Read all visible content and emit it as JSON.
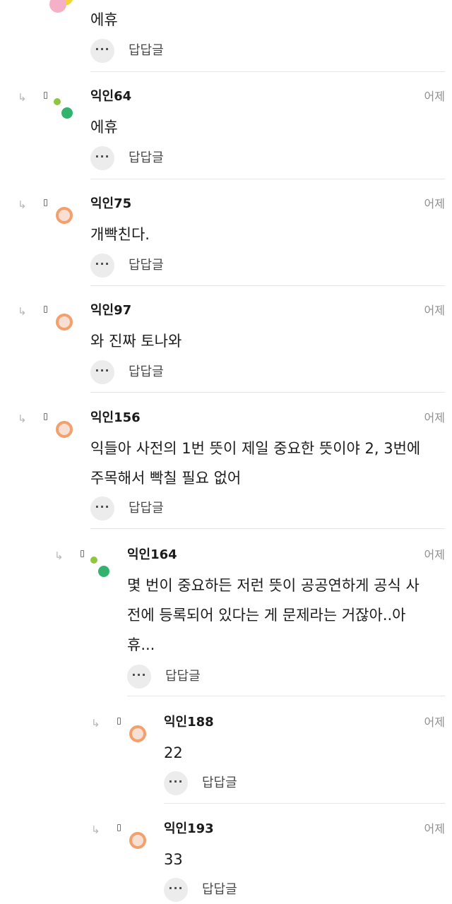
{
  "comments": [
    {
      "name": "",
      "time": "",
      "text": "에휴",
      "more": "···",
      "reply_label": "답답글",
      "avatar": "avatar-yellow-pink",
      "indent": 0,
      "show_reply_arrow": false
    },
    {
      "name": "익인64",
      "time": "어제",
      "text": "에휴",
      "more": "···",
      "reply_label": "답답글",
      "avatar": "avatar-green-dots",
      "indent": 0,
      "show_reply_arrow": true
    },
    {
      "name": "익인75",
      "time": "어제",
      "text": "개빡친다.",
      "more": "···",
      "reply_label": "답답글",
      "avatar": "avatar-orange-ring",
      "indent": 0,
      "show_reply_arrow": true
    },
    {
      "name": "익인97",
      "time": "어제",
      "text": "와 진짜 토나와",
      "more": "···",
      "reply_label": "답답글",
      "avatar": "avatar-orange-ring",
      "indent": 0,
      "show_reply_arrow": true
    },
    {
      "name": "익인156",
      "time": "어제",
      "text": "익들아 사전의 1번 뜻이 제일 중요한 뜻이야 2, 3번에\n주목해서 빡칠 필요 없어",
      "more": "···",
      "reply_label": "답답글",
      "avatar": "avatar-orange-ring",
      "indent": 0,
      "show_reply_arrow": true
    },
    {
      "name": "익인164",
      "time": "어제",
      "text": "몇 번이 중요하든 저런 뜻이 공공연하게 공식 사\n전에 등록되어 있다는 게 문제라는 거잖아..아\n휴...",
      "more": "···",
      "reply_label": "답답글",
      "avatar": "avatar-green-dots",
      "indent": 1,
      "show_reply_arrow": true
    },
    {
      "name": "익인188",
      "time": "어제",
      "text": "22",
      "more": "···",
      "reply_label": "답답글",
      "avatar": "avatar-orange-ring",
      "indent": 2,
      "show_reply_arrow": true
    },
    {
      "name": "익인193",
      "time": "어제",
      "text": "33",
      "more": "···",
      "reply_label": "답답글",
      "avatar": "avatar-orange-ring",
      "indent": 2,
      "show_reply_arrow": true
    }
  ],
  "icons": {
    "reply_arrow": "reply-arrow-icon",
    "more": "more-dots-icon"
  },
  "colors": {
    "text": "#1c1c1c",
    "time": "#909090",
    "divider": "#e6e6e6",
    "more_bg": "#ececec",
    "avatar_orange": "#f3a06d",
    "avatar_green_small": "#8ec63f",
    "avatar_green_large": "#34b36f",
    "avatar_yellow": "#f3d433",
    "avatar_pink": "#f5b0c8"
  }
}
